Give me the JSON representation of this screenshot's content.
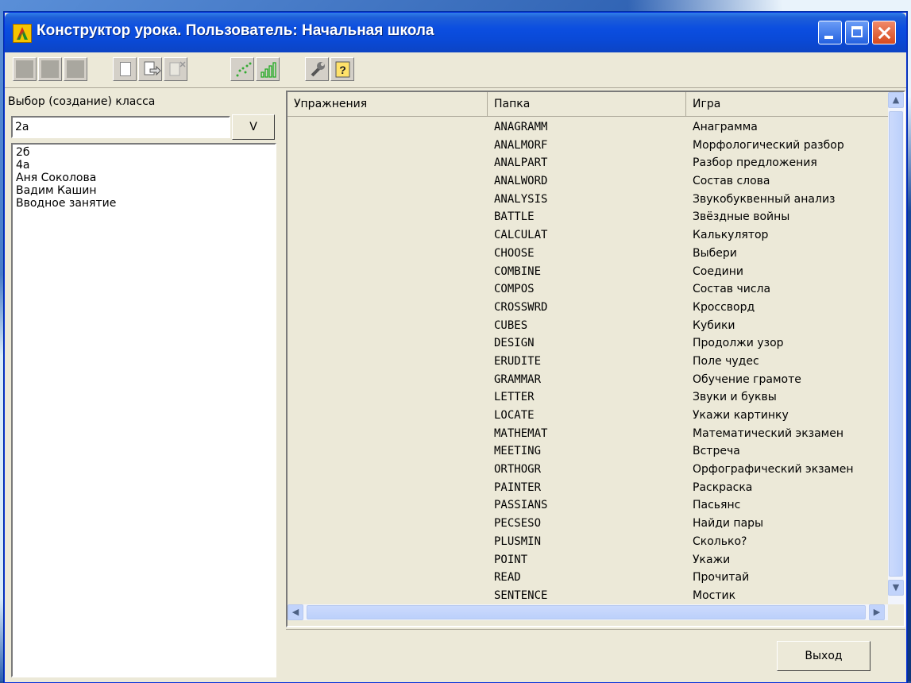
{
  "window": {
    "title": "Конструктор урока. Пользователь: Начальная школа"
  },
  "left": {
    "label": "Выбор (создание) класса",
    "input_value": "2а",
    "v_button": "V",
    "classes": [
      "2б",
      "4а",
      "Аня Соколова",
      "Вадим Кашин",
      "Вводное занятие"
    ]
  },
  "grid": {
    "headers": [
      "Упражнения",
      "Папка",
      "Игра"
    ],
    "rows": [
      [
        "ANAGRAMM",
        "Анаграмма"
      ],
      [
        "ANALMORF",
        "Морфологический разбор"
      ],
      [
        "ANALPART",
        "Разбор предложения"
      ],
      [
        "ANALWORD",
        "Состав слова"
      ],
      [
        "ANALYSIS",
        "Звукобуквенный анализ"
      ],
      [
        "BATTLE",
        "Звёздные войны"
      ],
      [
        "CALCULAT",
        "Калькулятор"
      ],
      [
        "CHOOSE",
        "Выбери"
      ],
      [
        "COMBINE",
        "Соедини"
      ],
      [
        "COMPOS",
        "Состав числа"
      ],
      [
        "CROSSWRD",
        "Кроссворд"
      ],
      [
        "CUBES",
        "Кубики"
      ],
      [
        "DESIGN",
        "Продолжи узор"
      ],
      [
        "ERUDITE",
        "Поле чудес"
      ],
      [
        "GRAMMAR",
        "Обучение грамоте"
      ],
      [
        "LETTER",
        "Звуки и буквы"
      ],
      [
        "LOCATE",
        "Укажи картинку"
      ],
      [
        "MATHEMAT",
        "Математический экзамен"
      ],
      [
        "MEETING",
        "Встреча"
      ],
      [
        "ORTHOGR",
        "Орфографический экзамен"
      ],
      [
        "PAINTER",
        "Раскраска"
      ],
      [
        "PASSIANS",
        "Пасьянс"
      ],
      [
        "PECSESO",
        "Найди пары"
      ],
      [
        "PLUSMIN",
        "Сколько?"
      ],
      [
        "POINT",
        "Укажи"
      ],
      [
        "READ",
        "Прочитай"
      ],
      [
        "SENTENCE",
        "Мостик"
      ]
    ]
  },
  "buttons": {
    "exit": "Выход"
  }
}
